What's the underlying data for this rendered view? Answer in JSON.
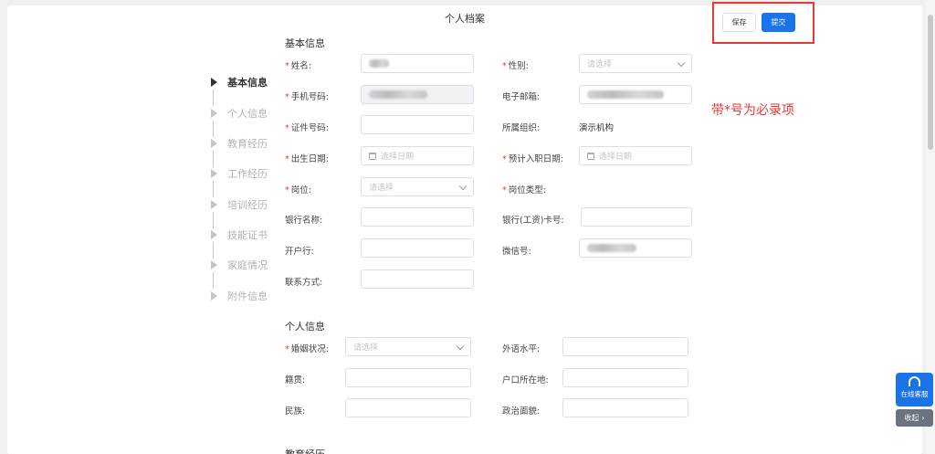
{
  "page": {
    "title": "个人档案"
  },
  "toolbar": {
    "save_label": "保存",
    "submit_label": "提交"
  },
  "annotation": "带*号为必录项",
  "steps": [
    "基本信息",
    "个人信息",
    "教育经历",
    "工作经历",
    "培训经历",
    "技能证书",
    "家庭情况",
    "附件信息"
  ],
  "basic": {
    "title": "基本信息",
    "name_label": "姓名:",
    "gender_label": "性别:",
    "gender_placeholder": "请选择",
    "phone_label": "手机号码:",
    "email_label": "电子邮箱:",
    "id_label": "证件号码:",
    "org_label": "所属组织:",
    "org_value": "演示机构",
    "birth_label": "出生日期:",
    "birth_placeholder": "选择日期",
    "entry_label": "预计入职日期:",
    "entry_placeholder": "选择日期",
    "post_label": "岗位:",
    "post_placeholder": "请选择",
    "post_type_label": "岗位类型:",
    "bank_label": "银行名称:",
    "card_label": "银行(工资)卡号:",
    "branch_label": "开户行:",
    "wechat_label": "微信号:",
    "contact_label": "联系方式:"
  },
  "personal": {
    "title": "个人信息",
    "marital_label": "婚姻状况:",
    "marital_placeholder": "请选择",
    "language_label": "外语水平:",
    "native_label": "籍贯:",
    "hukou_label": "户口所在地:",
    "ethnic_label": "民族:",
    "political_label": "政治面貌:"
  },
  "education": {
    "title": "教育经历"
  },
  "widgets": {
    "service_label": "在线客服",
    "collapse_label": "收起"
  }
}
